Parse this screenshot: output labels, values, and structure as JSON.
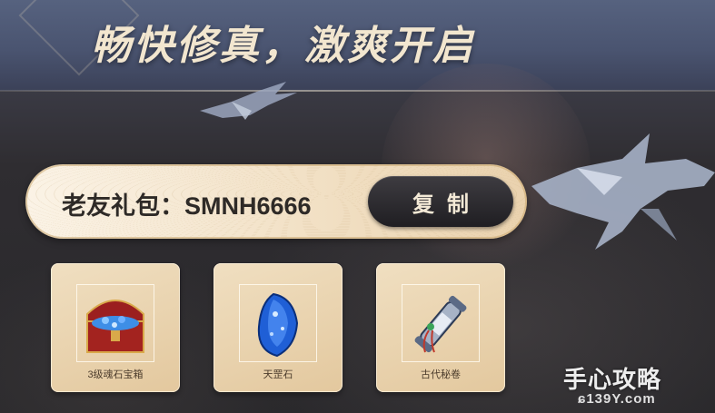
{
  "banner": {
    "title": "畅快修真，激爽开启"
  },
  "gift_code": {
    "label": "老友礼包：SMNH6666",
    "copy_label": "复制"
  },
  "rewards": [
    {
      "name": "3级魂石宝箱",
      "icon": "treasure-chest-icon"
    },
    {
      "name": "天罡石",
      "icon": "blue-gem-icon"
    },
    {
      "name": "古代秘卷",
      "icon": "scroll-icon"
    }
  ],
  "watermark": {
    "main": "手心攻略",
    "sub": "ɕ139Y.com"
  },
  "colors": {
    "title": "#f2e6cf",
    "card": "#e9d3ad",
    "button": "#2a292d"
  }
}
